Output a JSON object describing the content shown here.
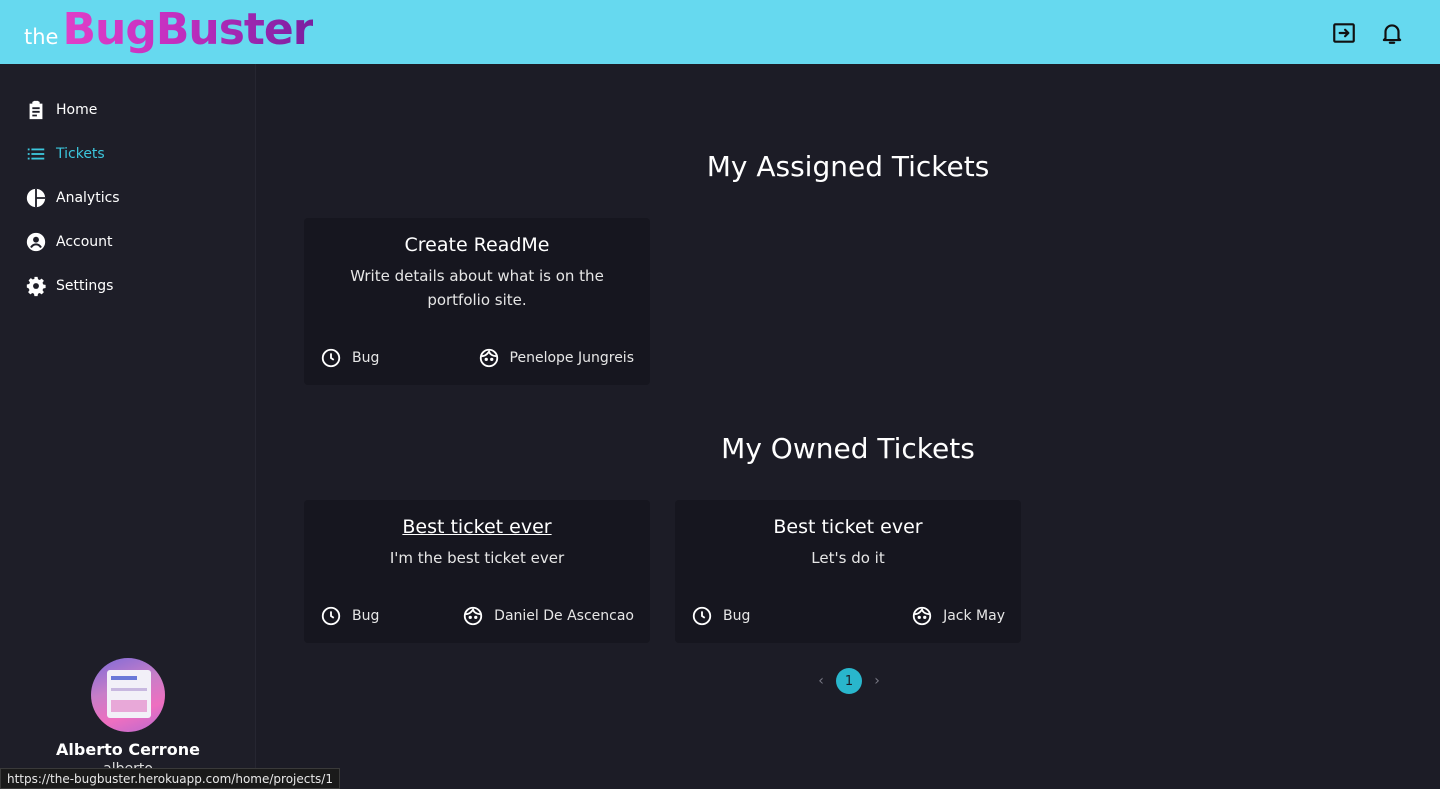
{
  "header": {
    "logo_prefix": "the",
    "logo_name": "BugBuster",
    "logout_icon": "logout-icon",
    "notifications_icon": "bell-icon"
  },
  "sidebar": {
    "items": [
      {
        "label": "Home",
        "icon": "clipboard-icon",
        "active": false
      },
      {
        "label": "Tickets",
        "icon": "list-icon",
        "active": true
      },
      {
        "label": "Analytics",
        "icon": "pie-chart-icon",
        "active": false
      },
      {
        "label": "Account",
        "icon": "account-circle-icon",
        "active": false
      },
      {
        "label": "Settings",
        "icon": "gear-icon",
        "active": false
      }
    ],
    "profile": {
      "name": "Alberto Cerrone",
      "username": "alberto"
    }
  },
  "assigned": {
    "title": "My Assigned Tickets",
    "tickets": [
      {
        "title": "Create ReadMe",
        "description": "Write details about what is on the portfolio site.",
        "type": "Bug",
        "user": "Penelope Jungreis"
      }
    ]
  },
  "owned": {
    "title": "My Owned Tickets",
    "tickets": [
      {
        "title": "Best ticket ever",
        "description": "I'm the best ticket ever",
        "type": "Bug",
        "user": "Daniel De Ascencao"
      },
      {
        "title": "Best ticket ever",
        "description": "Let's do it",
        "type": "Bug",
        "user": "Jack May"
      }
    ]
  },
  "pagination": {
    "prev": "‹",
    "current": "1",
    "next": "›"
  },
  "status_url": "https://the-bugbuster.herokuapp.com/home/projects/1",
  "colors": {
    "topbar": "#66d9ef",
    "background": "#1c1c26",
    "accent": "#3cc6dc",
    "logo_gradient_start": "#e040c8",
    "logo_gradient_end": "#7a1fa0"
  }
}
